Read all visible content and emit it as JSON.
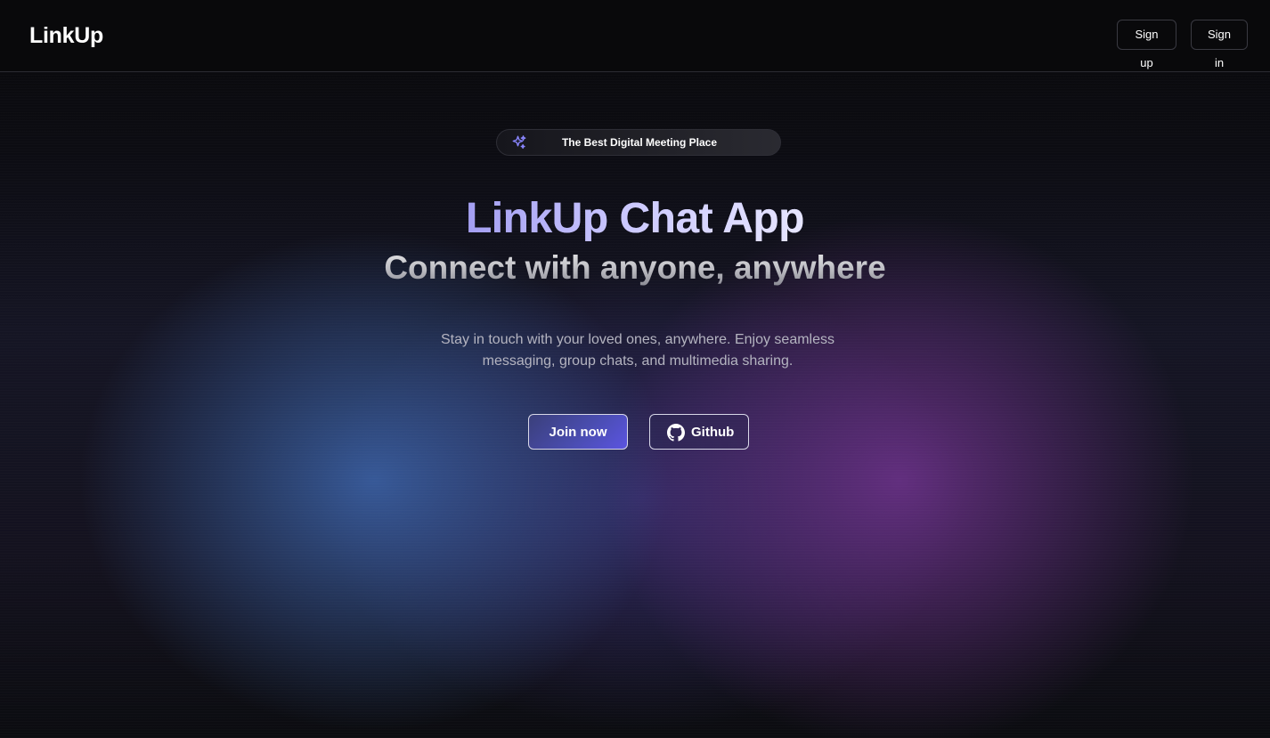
{
  "header": {
    "logo": "LinkUp",
    "signup_label": "Sign up",
    "signin_label": "Sign in"
  },
  "hero": {
    "badge_icon": "sparkles-icon",
    "badge_text": "The Best Digital Meeting Place",
    "title": "LinkUp Chat App",
    "subtitle": "Connect with anyone, anywhere",
    "description": "Stay in touch with your loved ones, anywhere. Enjoy seamless messaging, group chats, and multimedia sharing.",
    "join_label": "Join now",
    "github_icon": "github-icon",
    "github_label": "Github"
  },
  "colors": {
    "background": "#0a0a0c",
    "accent": "#5b54e0",
    "title_gradient_start": "#a9a4f5",
    "title_gradient_end": "#e4e2ff",
    "sparkle": "#8a86ff"
  }
}
